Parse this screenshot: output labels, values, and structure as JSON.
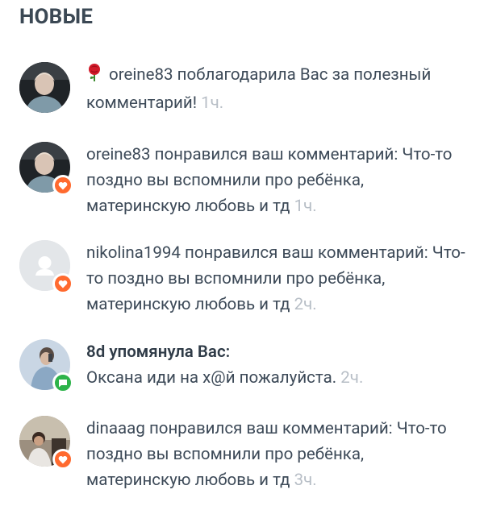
{
  "section_title": "НОВЫЕ",
  "notifications": [
    {
      "emoji": "🌹",
      "user": "oreine83",
      "action": "поблагодарила Вас за полезный комментарий!",
      "time": "1ч."
    },
    {
      "user": "oreine83",
      "action": "понравился ваш комментарий:",
      "comment": "Что-то поздно вы вспомнили про ребёнка, материнскую любовь и тд",
      "time": "1ч."
    },
    {
      "user": "nikolina1994",
      "action": "понравился ваш комментарий:",
      "comment": "Что-то поздно вы вспомнили про ребёнка, материнскую любовь и тд",
      "time": "2ч."
    },
    {
      "user": "8d",
      "action": "упомянула Вас:",
      "comment": "Оксана иди на х@й пожалуйста.",
      "time": "2ч."
    },
    {
      "user": "dinaaag",
      "action": "понравился ваш комментарий:",
      "comment": "Что-то поздно вы вспомнили про ребёнка, материнскую любовь и тд",
      "time": "3ч."
    }
  ],
  "colors": {
    "like_badge": "#ff6a2f",
    "mention_badge": "#2db34a",
    "time_text": "#b7bec6"
  }
}
